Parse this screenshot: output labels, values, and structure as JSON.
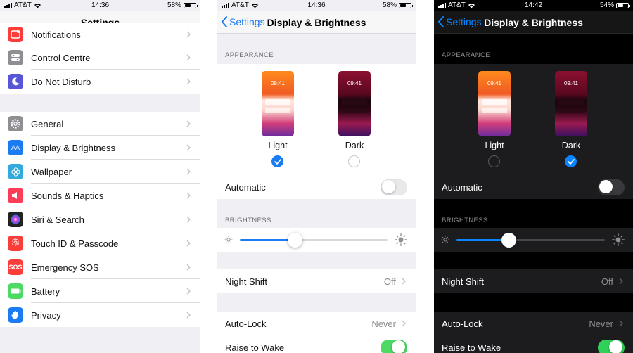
{
  "colors": {
    "accent": "#1a7bf2",
    "switch_on": "#4cd964",
    "dark_bg": "#000000",
    "dark_row": "#1c1c1e"
  },
  "panel1": {
    "status": {
      "carrier": "AT&T",
      "time": "14:36",
      "battery": "58%"
    },
    "title": "Settings",
    "items": [
      {
        "label": "Notifications",
        "icon": "notifications-icon",
        "color": "#fc3d39"
      },
      {
        "label": "Control Centre",
        "icon": "control-centre-icon",
        "color": "#8e8e93"
      },
      {
        "label": "Do Not Disturb",
        "icon": "moon-icon",
        "color": "#5856d6"
      },
      {
        "label": "General",
        "icon": "gear-icon",
        "color": "#8e8e93"
      },
      {
        "label": "Display & Brightness",
        "icon": "text-size-icon",
        "color": "#1a7bf2"
      },
      {
        "label": "Wallpaper",
        "icon": "wallpaper-flower-icon",
        "color": "#34aadc"
      },
      {
        "label": "Sounds & Haptics",
        "icon": "speaker-icon",
        "color": "#fc3d58"
      },
      {
        "label": "Siri & Search",
        "icon": "siri-icon",
        "color": "#222222"
      },
      {
        "label": "Touch ID & Passcode",
        "icon": "fingerprint-icon",
        "color": "#fc3d39"
      },
      {
        "label": "Emergency SOS",
        "icon": "sos-icon",
        "color": "#fc3d39",
        "text": "SOS"
      },
      {
        "label": "Battery",
        "icon": "battery-icon",
        "color": "#4cd964"
      },
      {
        "label": "Privacy",
        "icon": "hand-icon",
        "color": "#1a7bf2"
      }
    ]
  },
  "panel2": {
    "status": {
      "carrier": "AT&T",
      "time": "14:36",
      "battery": "58%"
    },
    "back": "Settings",
    "title": "Display & Brightness",
    "appearance_header": "APPEARANCE",
    "light": {
      "label": "Light",
      "time": "09:41"
    },
    "dark": {
      "label": "Dark",
      "time": "09:41"
    },
    "selected": "Light",
    "automatic": {
      "label": "Automatic",
      "on": false
    },
    "brightness_header": "BRIGHTNESS",
    "brightness": 0.37,
    "night_shift": {
      "label": "Night Shift",
      "value": "Off"
    },
    "auto_lock": {
      "label": "Auto-Lock",
      "value": "Never"
    },
    "raise_to_wake": {
      "label": "Raise to Wake",
      "on": true
    }
  },
  "panel3": {
    "status": {
      "carrier": "AT&T",
      "time": "14:42",
      "battery": "54%"
    },
    "back": "Settings",
    "title": "Display & Brightness",
    "appearance_header": "APPEARANCE",
    "light": {
      "label": "Light",
      "time": "09:41"
    },
    "dark": {
      "label": "Dark",
      "time": "09:41"
    },
    "selected": "Dark",
    "automatic": {
      "label": "Automatic",
      "on": false
    },
    "brightness_header": "BRIGHTNESS",
    "brightness": 0.35,
    "night_shift": {
      "label": "Night Shift",
      "value": "Off"
    },
    "auto_lock": {
      "label": "Auto-Lock",
      "value": "Never"
    },
    "raise_to_wake": {
      "label": "Raise to Wake",
      "on": true
    }
  }
}
